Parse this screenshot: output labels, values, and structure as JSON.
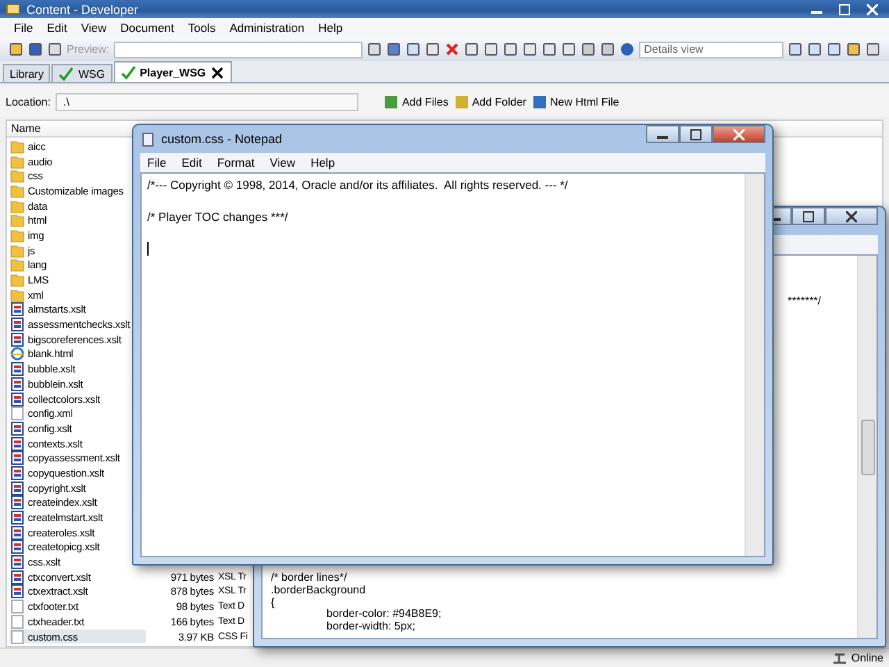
{
  "window": {
    "title": "Content - Developer"
  },
  "menu": [
    "File",
    "Edit",
    "View",
    "Document",
    "Tools",
    "Administration",
    "Help"
  ],
  "toolbar": {
    "preview_label": "Preview:",
    "view_select": "Details view"
  },
  "tabs": [
    {
      "label": "Library",
      "selected": false,
      "checked": false,
      "closable": false
    },
    {
      "label": "WSG",
      "selected": false,
      "checked": true,
      "closable": false
    },
    {
      "label": "Player_WSG",
      "selected": true,
      "checked": true,
      "closable": true
    }
  ],
  "location": {
    "label": "Location:",
    "value": ".\\"
  },
  "actions": [
    "Add Files",
    "Add Folder",
    "New Html File"
  ],
  "table": {
    "columns": [
      "Name"
    ],
    "rows": [
      {
        "name": "aicc",
        "kind": "folder",
        "selected": false
      },
      {
        "name": "audio",
        "kind": "folder",
        "selected": false
      },
      {
        "name": "css",
        "kind": "folder",
        "selected": false
      },
      {
        "name": "Customizable images",
        "kind": "folder",
        "selected": false
      },
      {
        "name": "data",
        "kind": "folder",
        "selected": false
      },
      {
        "name": "html",
        "kind": "folder",
        "selected": false
      },
      {
        "name": "img",
        "kind": "folder",
        "selected": false
      },
      {
        "name": "js",
        "kind": "folder",
        "selected": false
      },
      {
        "name": "lang",
        "kind": "folder",
        "selected": false
      },
      {
        "name": "LMS",
        "kind": "folder",
        "selected": false
      },
      {
        "name": "xml",
        "kind": "folder",
        "selected": false
      },
      {
        "name": "almstarts.xslt",
        "kind": "xslt",
        "selected": false
      },
      {
        "name": "assessmentchecks.xslt",
        "kind": "xslt",
        "selected": false
      },
      {
        "name": "bigscoreferences.xslt",
        "kind": "xslt",
        "selected": false
      },
      {
        "name": "blank.html",
        "kind": "html",
        "selected": false
      },
      {
        "name": "bubble.xslt",
        "kind": "xslt",
        "selected": false
      },
      {
        "name": "bubblein.xslt",
        "kind": "xslt",
        "selected": false
      },
      {
        "name": "collectcolors.xslt",
        "kind": "xslt",
        "selected": false
      },
      {
        "name": "config.xml",
        "kind": "text",
        "selected": false
      },
      {
        "name": "config.xslt",
        "kind": "xslt",
        "selected": false
      },
      {
        "name": "contexts.xslt",
        "kind": "xslt",
        "selected": false
      },
      {
        "name": "copyassessment.xslt",
        "kind": "xslt",
        "selected": false
      },
      {
        "name": "copyquestion.xslt",
        "kind": "xslt",
        "selected": false
      },
      {
        "name": "copyright.xslt",
        "kind": "xslt",
        "selected": false
      },
      {
        "name": "createindex.xslt",
        "kind": "xslt",
        "selected": false
      },
      {
        "name": "createlmstart.xslt",
        "kind": "xslt",
        "selected": false
      },
      {
        "name": "createroles.xslt",
        "kind": "xslt",
        "selected": false
      },
      {
        "name": "createtopicg.xslt",
        "kind": "xslt",
        "selected": false
      },
      {
        "name": "css.xslt",
        "kind": "xslt",
        "selected": false
      },
      {
        "name": "ctxconvert.xslt",
        "kind": "xslt",
        "size": "971 bytes",
        "type": "XSL Tr",
        "selected": false
      },
      {
        "name": "ctxextract.xslt",
        "kind": "xslt",
        "size": "878 bytes",
        "type": "XSL Tr",
        "selected": false
      },
      {
        "name": "ctxfooter.txt",
        "kind": "text",
        "size": "98 bytes",
        "type": "Text D",
        "selected": false
      },
      {
        "name": "ctxheader.txt",
        "kind": "text",
        "size": "166 bytes",
        "type": "Text D",
        "selected": false
      },
      {
        "name": "custom.css",
        "kind": "text",
        "size": "3.97 KB",
        "type": "CSS Fi",
        "selected": true
      }
    ]
  },
  "status_bar": {
    "text": "Online"
  },
  "back_editor": {
    "lines": [
      "*******/",
      "/* border lines*/",
      ".borderBackground",
      "{",
      "\tborder-color: #94B8E9;",
      "\tborder-width: 5px;"
    ]
  },
  "notepad": {
    "title": "custom.css - Notepad",
    "menu": [
      "File",
      "Edit",
      "Format",
      "View",
      "Help"
    ],
    "lines": [
      "/*--- Copyright © 1998, 2014, Oracle and/or its affiliates.  All rights reserved. --- */",
      "/* Player TOC changes ***/"
    ]
  }
}
